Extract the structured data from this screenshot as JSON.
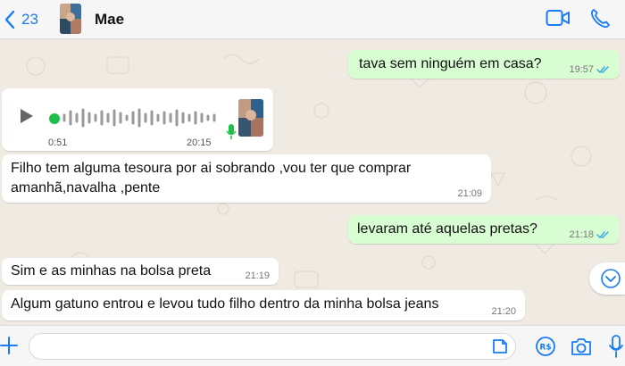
{
  "header": {
    "unread_count": "23",
    "contact_name": "Mae"
  },
  "messages": [
    {
      "text": "tava sem ninguém em casa?",
      "time": "19:57",
      "direction": "outgoing",
      "read": true
    },
    {
      "type": "voice",
      "duration": "0:51",
      "time": "20:15",
      "direction": "incoming"
    },
    {
      "text_line1": "Filho tem alguma tesoura por ai sobrando ,vou ter que comprar",
      "text_line2": "amanhã,navalha ,pente",
      "time": "21:09",
      "direction": "incoming"
    },
    {
      "text": "levaram até aquelas pretas?",
      "time": "21:18",
      "direction": "outgoing",
      "read": true
    },
    {
      "text": "Sim e as minhas na bolsa preta",
      "time": "21:19",
      "direction": "incoming"
    },
    {
      "text": "Algum gatuno entrou e levou tudo filho dentro da minha bolsa jeans",
      "time": "21:20",
      "direction": "incoming"
    }
  ],
  "composer": {
    "value": ""
  },
  "colors": {
    "accent": "#1a7cf5",
    "outgoing_bubble": "#d9fdd3",
    "incoming_bubble": "#ffffff",
    "background": "#efeae2",
    "voice_dot": "#1fbf4c"
  },
  "icons": [
    "chevron-left-icon",
    "video-call-icon",
    "phone-icon",
    "play-icon",
    "mic-icon",
    "plus-icon",
    "sticker-icon",
    "payment-icon",
    "camera-icon",
    "chevron-down-icon",
    "double-check-icon"
  ]
}
